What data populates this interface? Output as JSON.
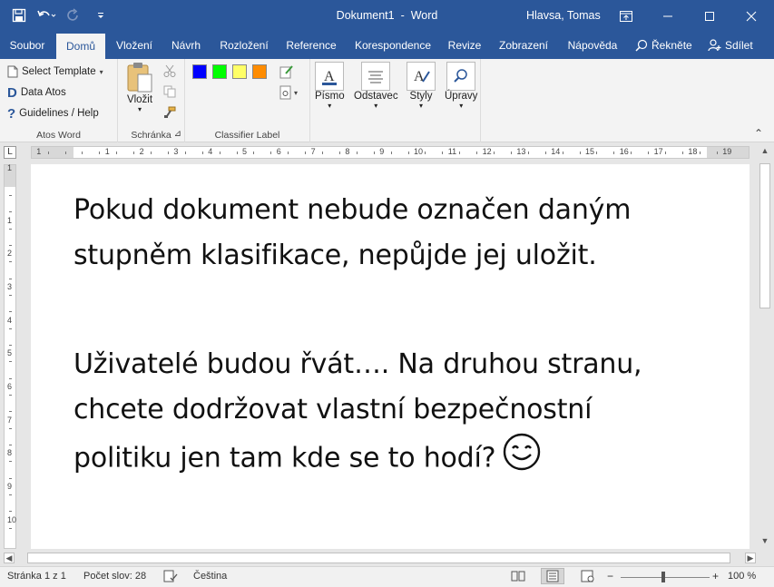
{
  "window": {
    "doc_title": "Dokument1",
    "separator": "-",
    "app_name": "Word",
    "user_name": "Hlavsa, Tomas"
  },
  "colors": {
    "accent": "#2b579a",
    "swatch_blue": "#0000ff",
    "swatch_green": "#00ff00",
    "swatch_yellow": "#ffff66",
    "swatch_orange": "#ff8c00"
  },
  "tabs": [
    {
      "label": "Soubor"
    },
    {
      "label": "Domů"
    },
    {
      "label": "Vložení"
    },
    {
      "label": "Návrh"
    },
    {
      "label": "Rozložení"
    },
    {
      "label": "Reference"
    },
    {
      "label": "Korespondence"
    },
    {
      "label": "Revize"
    },
    {
      "label": "Zobrazení"
    },
    {
      "label": "Nápověda"
    }
  ],
  "tell_me": "Řekněte",
  "share": "Sdílet",
  "ribbon": {
    "atos": {
      "select_template": "Select Template",
      "data_atos": "Data Atos",
      "guidelines": "Guidelines / Help",
      "group_label": "Atos Word"
    },
    "clipboard": {
      "paste": "Vložit",
      "group_label": "Schránka"
    },
    "classifier": {
      "group_label": "Classifier Label"
    },
    "font": "Písmo",
    "paragraph": "Odstavec",
    "styles": "Styly",
    "editing": "Úpravy"
  },
  "ruler_numbers": [
    "1",
    "1",
    "2",
    "3",
    "4",
    "5",
    "6",
    "7",
    "8",
    "9",
    "10",
    "11",
    "12",
    "13",
    "14",
    "15",
    "16",
    "17",
    "18",
    "19"
  ],
  "vruler_numbers": [
    "1",
    "1",
    "2",
    "3",
    "4",
    "5",
    "6",
    "7",
    "8",
    "9",
    "10",
    "11",
    "12"
  ],
  "document": {
    "paragraphs": [
      {
        "lines": [
          "Pokud dokument nebude označen daným",
          "stupněm klasifikace, nepůjde jej uložit."
        ]
      },
      {
        "lines": [
          "Uživatelé budou řvát…. Na druhou stranu,",
          "chcete dodržovat vlastní bezpečnostní",
          "politiku jen tam kde se to hodí?"
        ]
      }
    ]
  },
  "status": {
    "page": "Stránka 1 z 1",
    "words": "Počet slov: 28",
    "language": "Čeština",
    "zoom": "100 %"
  }
}
